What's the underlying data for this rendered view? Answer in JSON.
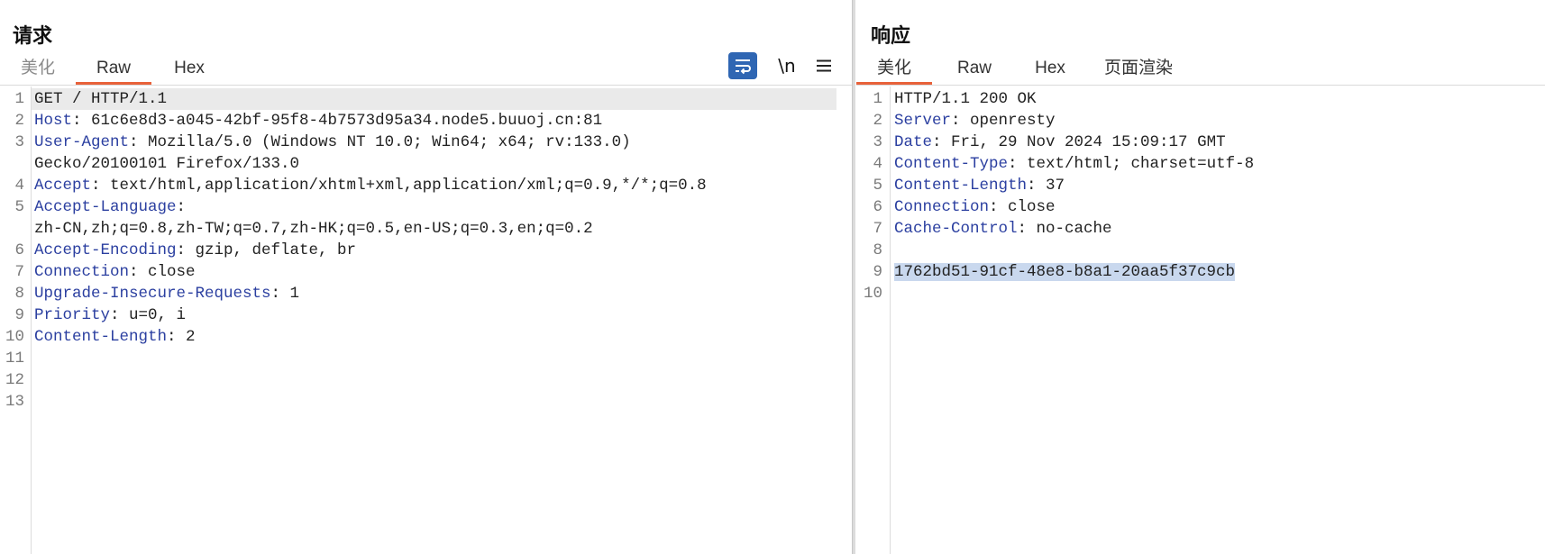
{
  "request": {
    "title": "请求",
    "tabs": [
      {
        "label": "美化"
      },
      {
        "label": "Raw"
      },
      {
        "label": "Hex"
      }
    ],
    "active_tab": "Raw",
    "newline_toggle": "\\n",
    "icons": [
      "word-wrap-icon",
      "newline-icon",
      "hamburger-menu-icon"
    ],
    "line_numbers": [
      "1",
      "2",
      "3",
      "4",
      "5",
      "6",
      "7",
      "8",
      "9",
      "10",
      "11",
      "12",
      "13"
    ],
    "rows": [
      {
        "name": "GET / HTTP/1.1",
        "value": ""
      },
      {
        "name": "Host",
        "value": ": 61c6e8d3-a045-42bf-95f8-4b7573d95a34.node5.buuoj.cn:81"
      },
      {
        "name": "User-Agent",
        "value": ": Mozilla/5.0 (Windows NT 10.0; Win64; x64; rv:133.0)"
      },
      {
        "name": "",
        "value": "Gecko/20100101 Firefox/133.0"
      },
      {
        "name": "Accept",
        "value": ": text/html,application/xhtml+xml,application/xml;q=0.9,*/*;q=0.8"
      },
      {
        "name": "Accept-Language",
        "value": ":"
      },
      {
        "name": "",
        "value": "zh-CN,zh;q=0.8,zh-TW;q=0.7,zh-HK;q=0.5,en-US;q=0.3,en;q=0.2"
      },
      {
        "name": "Accept-Encoding",
        "value": ": gzip, deflate, br"
      },
      {
        "name": "Connection",
        "value": ": close"
      },
      {
        "name": "Upgrade-Insecure-Requests",
        "value": ": 1"
      },
      {
        "name": "Priority",
        "value": ": u=0, i"
      },
      {
        "name": "Content-Length",
        "value": ": 2"
      }
    ]
  },
  "response": {
    "title": "响应",
    "tabs": [
      {
        "label": "美化"
      },
      {
        "label": "Raw"
      },
      {
        "label": "Hex"
      },
      {
        "label": "页面渲染"
      }
    ],
    "active_tab": "美化",
    "line_numbers": [
      "1",
      "2",
      "3",
      "4",
      "5",
      "6",
      "7",
      "8",
      "9",
      "10"
    ],
    "rows": [
      {
        "name": "",
        "value": "HTTP/1.1 200 OK"
      },
      {
        "name": "Server",
        "value": ": openresty"
      },
      {
        "name": "Date",
        "value": ": Fri, 29 Nov 2024 15:09:17 GMT"
      },
      {
        "name": "Content-Type",
        "value": ": text/html; charset=utf-8"
      },
      {
        "name": "Content-Length",
        "value": ": 37"
      },
      {
        "name": "Connection",
        "value": ": close"
      },
      {
        "name": "Cache-Control",
        "value": ": no-cache"
      }
    ],
    "body": "1762bd51-91cf-48e8-b8a1-20aa5f37c9cb"
  },
  "colors": {
    "accent_tab_underline": "#e8623a",
    "header_name": "#2b3fa0",
    "wrap_button": "#2f66b3",
    "selection": "#c9d8ee"
  }
}
